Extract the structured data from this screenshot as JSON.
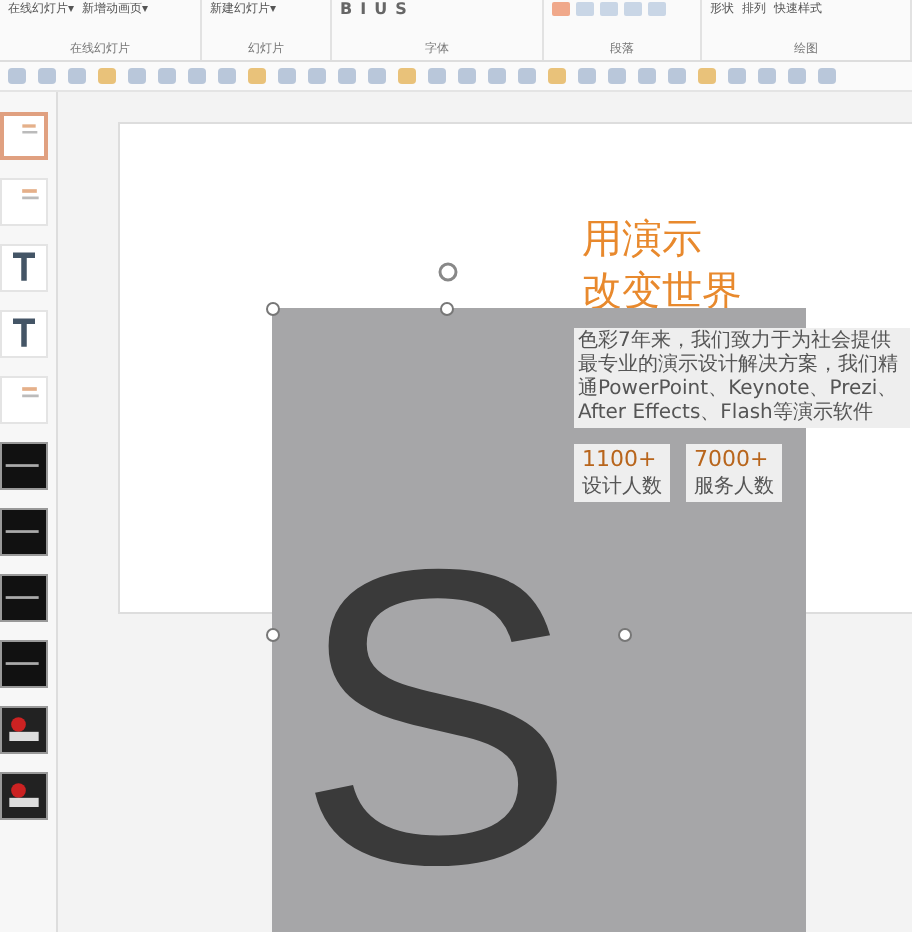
{
  "ribbon": {
    "groups": [
      {
        "label": "在线幻灯片",
        "buttons": [
          "在线幻灯片▾",
          "新增动画页▾"
        ]
      },
      {
        "label": "幻灯片",
        "buttons": [
          "新建幻灯片▾"
        ]
      },
      {
        "label": "字体",
        "buttons": [
          "B",
          "I",
          "U",
          "S"
        ]
      },
      {
        "label": "段落"
      },
      {
        "label": "绘图",
        "buttons": [
          "形状",
          "排列",
          "快速样式"
        ]
      }
    ]
  },
  "thumbnails": [
    {
      "kind": "light",
      "selected": true
    },
    {
      "kind": "light",
      "selected": false
    },
    {
      "kind": "letter",
      "selected": false
    },
    {
      "kind": "letter",
      "selected": false
    },
    {
      "kind": "light",
      "selected": false
    },
    {
      "kind": "dark",
      "selected": false
    },
    {
      "kind": "dark",
      "selected": false
    },
    {
      "kind": "dark",
      "selected": false
    },
    {
      "kind": "dark",
      "selected": false
    },
    {
      "kind": "flower",
      "selected": false
    },
    {
      "kind": "flower",
      "selected": false
    }
  ],
  "slide": {
    "title_lines": [
      "用演示",
      "改变世界"
    ],
    "body": "色彩7年来，我们致力于为社会提供最专业的演示设计解决方案，我们精通PowerPoint、Keynote、Prezi、After Effects、Flash等演示软件",
    "stats": [
      {
        "value": "1100+",
        "label": "设计人数"
      },
      {
        "value": "7000+",
        "label": "服务人数"
      }
    ],
    "image_letter": "S"
  }
}
